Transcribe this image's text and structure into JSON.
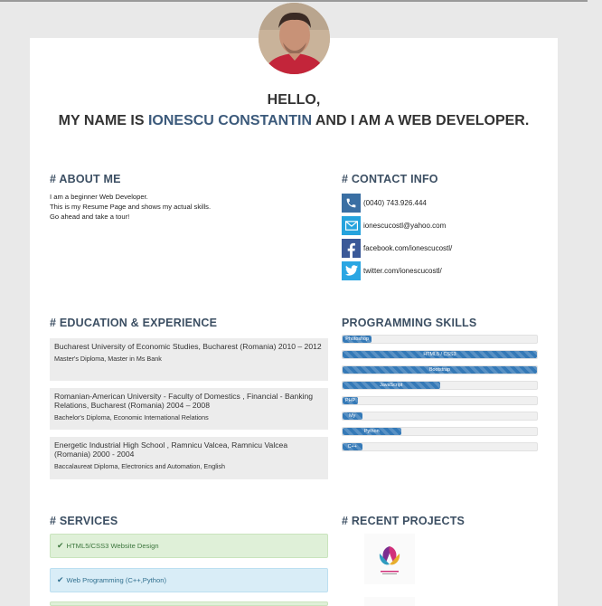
{
  "hero": {
    "line1": "HELLO,",
    "prefix": "MY NAME IS ",
    "name": "IONESCU CONSTANTIN",
    "suffix": " AND I AM A WEB DEVELOPER."
  },
  "about": {
    "heading": "# ABOUT ME",
    "lines": [
      "I am a beginner Web Developer.",
      "This is my Resume Page and shows my actual skills.",
      "Go ahead and take a tour!"
    ]
  },
  "contact": {
    "heading": "# CONTACT INFO",
    "items": [
      {
        "icon": "phone-icon",
        "text": "(0040) 743.926.444",
        "color": "#3a6fa3"
      },
      {
        "icon": "envelope-icon",
        "text": "ionescucostl@yahoo.com",
        "color": "#25a3dd"
      },
      {
        "icon": "facebook-icon",
        "text": "facebook.com/ionescucostl/",
        "color": "#3b5998"
      },
      {
        "icon": "twitter-icon",
        "text": "twitter.com/ionescucostl/",
        "color": "#2aa6e3"
      }
    ]
  },
  "education": {
    "heading": "# EDUCATION & EXPERIENCE",
    "items": [
      {
        "title": "Bucharest University of Economic Studies, Bucharest (Romania) 2010 – 2012",
        "sub": "Master's Diploma, Master in Ms Bank"
      },
      {
        "title": "Romanian-American University - Faculty of Domestics , Financial - Banking Relations, Bucharest (Romania) 2004 – 2008",
        "sub": "Bachelor's Diploma, Economic International Relations"
      },
      {
        "title": "Energetic Industrial High School , Ramnicu Valcea, Ramnicu Valcea (Romania) 2000 - 2004",
        "sub": "Baccalaureat Diploma, Electronics and Automation, English"
      }
    ]
  },
  "skills": {
    "heading": "PROGRAMMING SKILLS",
    "items": [
      {
        "label": "Photoshop",
        "level": 0.15
      },
      {
        "label": "HTML5 / CSS3",
        "level": 1.0
      },
      {
        "label": "Bootstrap",
        "level": 1.0
      },
      {
        "label": "JavaScript",
        "level": 0.5
      },
      {
        "label": "PHP",
        "level": 0.08
      },
      {
        "label": "My",
        "level": 0.1
      },
      {
        "label": "Python",
        "level": 0.3
      },
      {
        "label": "C++",
        "level": 0.1
      }
    ]
  },
  "services": {
    "heading": "# SERVICES",
    "items": [
      {
        "label": "HTML5/CSS3 Website Design",
        "style": "green"
      },
      {
        "label": "Web Programming (C++,Python)",
        "style": "blue"
      }
    ]
  },
  "projects": {
    "heading": "# RECENT PROJECTS",
    "logo_colors": [
      "#7b2d8f",
      "#d1307a",
      "#2f9bbf",
      "#e7ad2c"
    ]
  }
}
